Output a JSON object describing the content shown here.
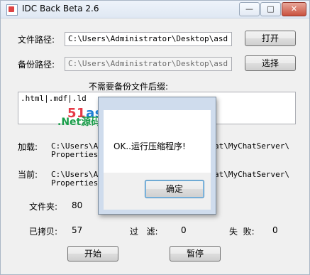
{
  "window": {
    "title": "IDC Back Beta 2.6"
  },
  "titlebar": {
    "minimize": "—",
    "maximize": "□",
    "close": "✕"
  },
  "source": {
    "label": "文件路径:",
    "value": "C:\\Users\\Administrator\\Desktop\\asd",
    "button": "打开"
  },
  "backup": {
    "label": "备份路径:",
    "value": "C:\\Users\\Administrator\\Desktop\\asd",
    "button": "选择"
  },
  "exclude": {
    "label": "不需要备份文件后缀:",
    "value": ".html|.mdf|.ld"
  },
  "loading": {
    "label": "加载:",
    "line1_left": "C:\\Users\\Adm",
    "line1_right": "at\\MyChatServer\\",
    "line2": "Properties"
  },
  "current": {
    "label": "当前:",
    "line1_left": "C:\\Users\\Adm",
    "line1_right": "at\\MyChatServer\\",
    "line2": "Properties\\S"
  },
  "stats": {
    "folders_label": "文件夹:",
    "folders_value": "80",
    "copied_label": "已拷贝:",
    "copied_value": "57",
    "filtered_label": "过   滤:",
    "filtered_value": "0",
    "failed_label": "失  败:",
    "failed_value": "0"
  },
  "actions": {
    "start": "开始",
    "pause": "暂停"
  },
  "watermark": {
    "brand_red": "51",
    "brand_blue": "aspx.com",
    "tagline": ".Net源码服务专家"
  },
  "dialog": {
    "message": "OK..运行压缩程序!",
    "ok": "确定"
  }
}
